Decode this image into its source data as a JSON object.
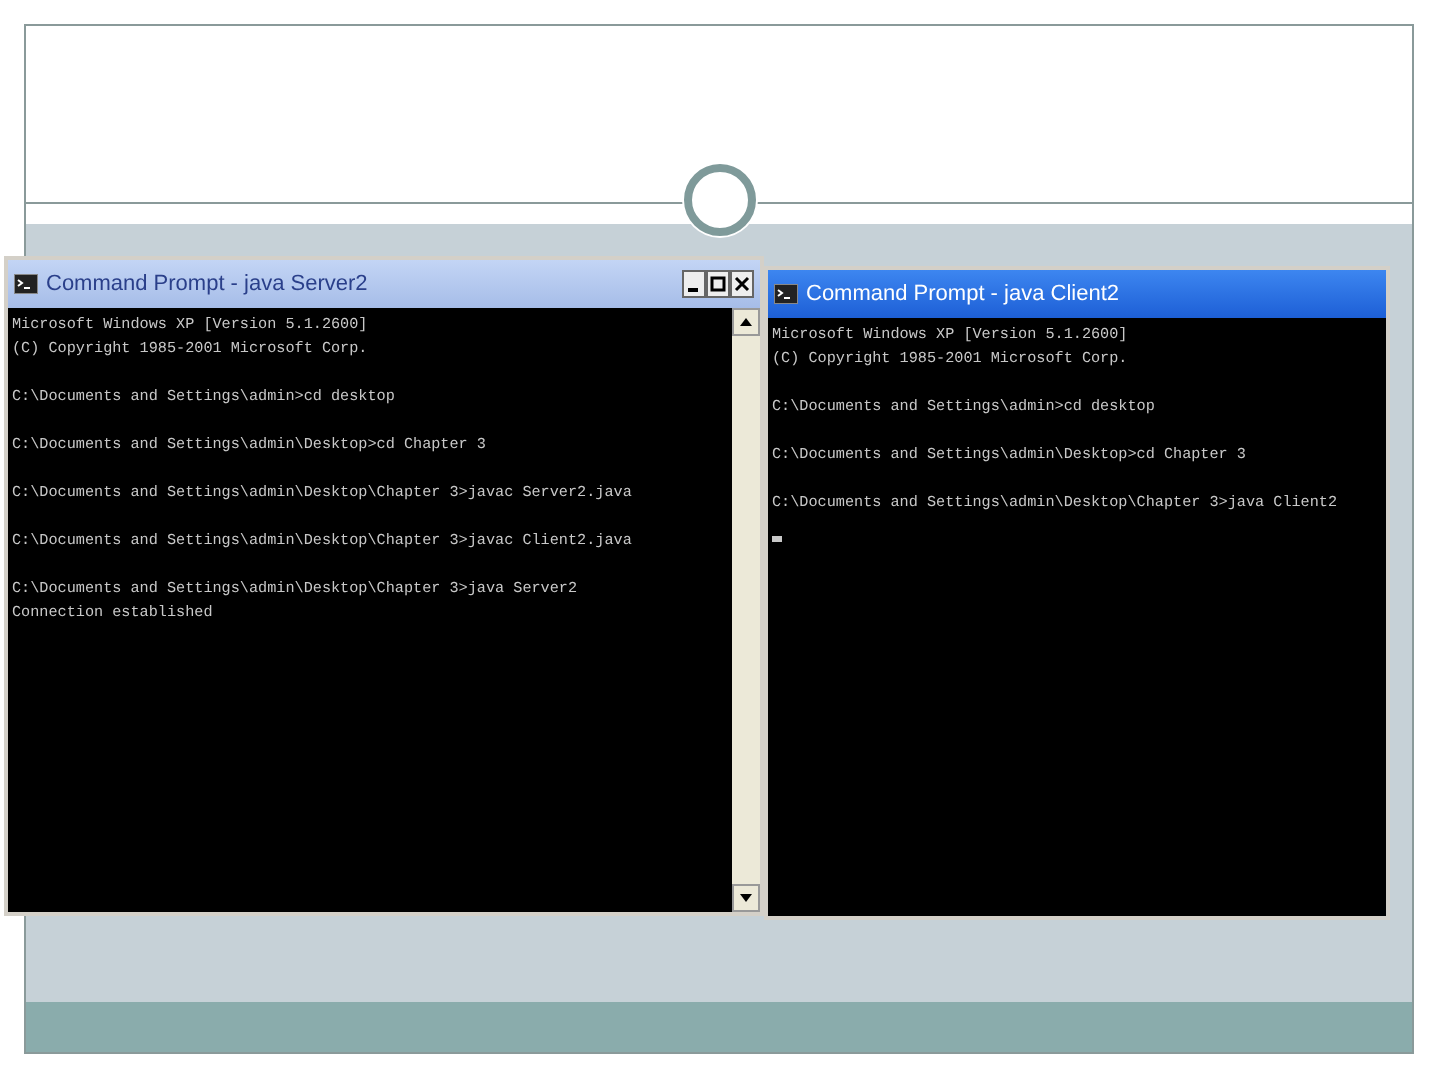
{
  "windows": [
    {
      "title": "Command Prompt - java Server2",
      "active": false,
      "scrollbar": true,
      "cursor": false,
      "blocks": [
        [
          "Microsoft Windows XP [Version 5.1.2600]",
          "(C) Copyright 1985-2001 Microsoft Corp."
        ],
        [
          "C:\\Documents and Settings\\admin>cd desktop"
        ],
        [
          "C:\\Documents and Settings\\admin\\Desktop>cd Chapter 3"
        ],
        [
          "C:\\Documents and Settings\\admin\\Desktop\\Chapter 3>javac Server2.java"
        ],
        [
          "C:\\Documents and Settings\\admin\\Desktop\\Chapter 3>javac Client2.java"
        ],
        [
          "C:\\Documents and Settings\\admin\\Desktop\\Chapter 3>java Server2",
          "Connection established"
        ]
      ]
    },
    {
      "title": "Command Prompt - java Client2",
      "active": true,
      "scrollbar": false,
      "cursor": true,
      "blocks": [
        [
          "Microsoft Windows XP [Version 5.1.2600]",
          "(C) Copyright 1985-2001 Microsoft Corp."
        ],
        [
          "C:\\Documents and Settings\\admin>cd desktop"
        ],
        [
          "C:\\Documents and Settings\\admin\\Desktop>cd Chapter 3"
        ],
        [
          "C:\\Documents and Settings\\admin\\Desktop\\Chapter 3>java Client2"
        ]
      ]
    }
  ]
}
